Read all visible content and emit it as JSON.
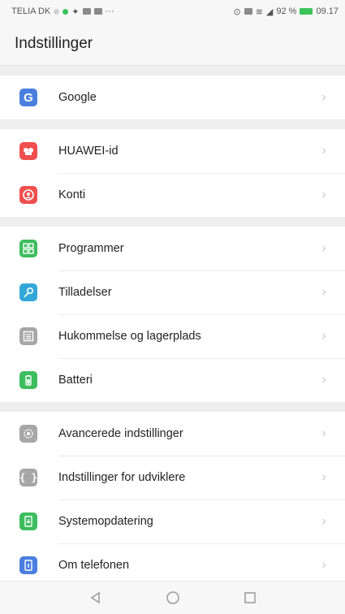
{
  "status_bar": {
    "carrier": "TELIA DK",
    "battery": "92 %",
    "time": "09.17"
  },
  "header": {
    "title": "Indstillinger"
  },
  "groups": [
    {
      "items": [
        {
          "label": "Google",
          "icon": "google-icon",
          "color": "#4a7fe0"
        }
      ]
    },
    {
      "items": [
        {
          "label": "HUAWEI-id",
          "icon": "huawei-id-icon",
          "color": "#ef4f4f"
        },
        {
          "label": "Konti",
          "icon": "account-icon",
          "color": "#ef4f4f"
        }
      ]
    },
    {
      "items": [
        {
          "label": "Programmer",
          "icon": "apps-grid-icon",
          "color": "#3dbd5e"
        },
        {
          "label": "Tilladelser",
          "icon": "key-icon",
          "color": "#33a8d8"
        },
        {
          "label": "Hukommelse og lagerplads",
          "icon": "storage-icon",
          "color": "#a7a7a7"
        },
        {
          "label": "Batteri",
          "icon": "battery-icon",
          "color": "#3dbd5e"
        }
      ]
    },
    {
      "items": [
        {
          "label": "Avancerede indstillinger",
          "icon": "gear-icon",
          "color": "#a7a7a7"
        },
        {
          "label": "Indstillinger for udviklere",
          "icon": "developer-braces-icon",
          "color": "#a7a7a7"
        },
        {
          "label": "Systemopdatering",
          "icon": "system-update-icon",
          "color": "#3dbd5e"
        },
        {
          "label": "Om telefonen",
          "icon": "phone-info-icon",
          "color": "#4a7fe0"
        }
      ]
    }
  ],
  "navbar": {
    "back": "back-triangle-icon",
    "home": "home-circle-icon",
    "recents": "recents-square-icon"
  }
}
